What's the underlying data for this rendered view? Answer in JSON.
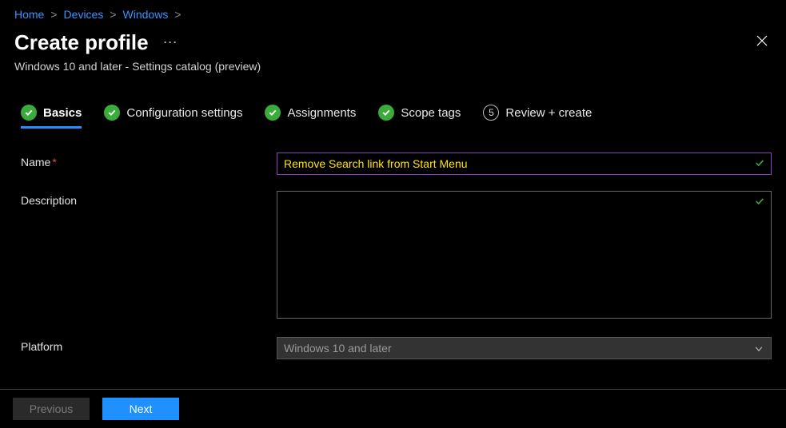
{
  "breadcrumb": [
    {
      "label": "Home"
    },
    {
      "label": "Devices"
    },
    {
      "label": "Windows"
    }
  ],
  "header": {
    "title": "Create profile",
    "subtitle": "Windows 10 and later - Settings catalog (preview)"
  },
  "wizard": {
    "steps": [
      {
        "label": "Basics",
        "state": "check",
        "active": true
      },
      {
        "label": "Configuration settings",
        "state": "check",
        "active": false
      },
      {
        "label": "Assignments",
        "state": "check",
        "active": false
      },
      {
        "label": "Scope tags",
        "state": "check",
        "active": false
      },
      {
        "label": "Review + create",
        "state": "num",
        "num": "5",
        "active": false
      }
    ]
  },
  "form": {
    "name_label": "Name",
    "name_value": "Remove Search link from Start Menu",
    "description_label": "Description",
    "description_value": "",
    "platform_label": "Platform",
    "platform_value": "Windows 10 and later"
  },
  "footer": {
    "previous": "Previous",
    "next": "Next"
  }
}
